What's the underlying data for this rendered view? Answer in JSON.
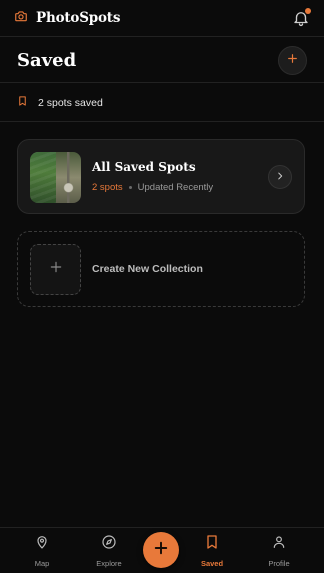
{
  "app": {
    "title": "PhotoSpots",
    "logo_icon": "camera-icon",
    "notification_icon": "bell-icon",
    "accent_color": "#e8793a"
  },
  "header": {
    "title": "Saved",
    "add_icon": "plus-icon"
  },
  "saved_summary": {
    "icon": "bookmark-icon",
    "text": "2 spots saved"
  },
  "collections": [
    {
      "title": "All Saved Spots",
      "count": "2 spots",
      "updated": "Updated Recently",
      "arrow_icon": "chevron-right-icon"
    }
  ],
  "new_collection": {
    "label": "Create New Collection",
    "icon": "plus-icon"
  },
  "bottom_nav": {
    "items": [
      {
        "label": "Map",
        "icon": "map-pin-icon",
        "active": false
      },
      {
        "label": "Explore",
        "icon": "compass-icon",
        "active": false
      },
      {
        "label": "Saved",
        "icon": "bookmark-icon",
        "active": true
      },
      {
        "label": "Profile",
        "icon": "user-icon",
        "active": false
      }
    ],
    "fab_icon": "plus-icon"
  }
}
